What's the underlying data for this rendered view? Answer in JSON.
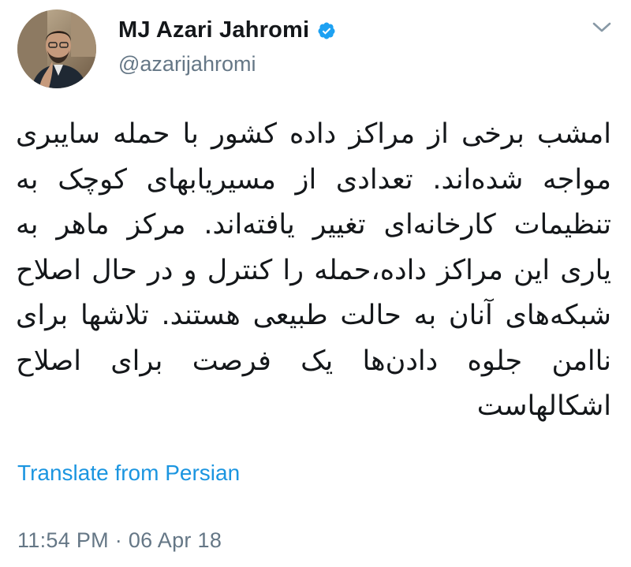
{
  "author": {
    "display_name": "MJ Azari Jahromi",
    "handle": "@azarijahromi",
    "verified": true,
    "avatar_icon": "profile-photo"
  },
  "tweet": {
    "text": "امشب برخی از مراکز داده کشور با حمله سایبری مواجه شده‌اند. تعدادی از مسیریابهای کوچک به تنظیمات کارخانه‌ای تغییر یافته‌اند. مرکز ماهر به یاری این مراکز داده،حمله را کنترل و در حال اصلاح شبکه‌های آنان به حالت طبیعی هستند. تلاشها برای ناامن جلوه دادن‌ها یک فرصت برای اصلاح اشکالهاست",
    "translate_label": "Translate from Persian",
    "timestamp": "11:54 PM · 06 Apr 18"
  },
  "icons": {
    "verified": "verified-badge-icon",
    "menu": "chevron-down-icon"
  },
  "colors": {
    "verified_blue": "#1da1f2",
    "link_blue": "#1b95e0",
    "secondary_text": "#657786",
    "primary_text": "#14171a"
  }
}
